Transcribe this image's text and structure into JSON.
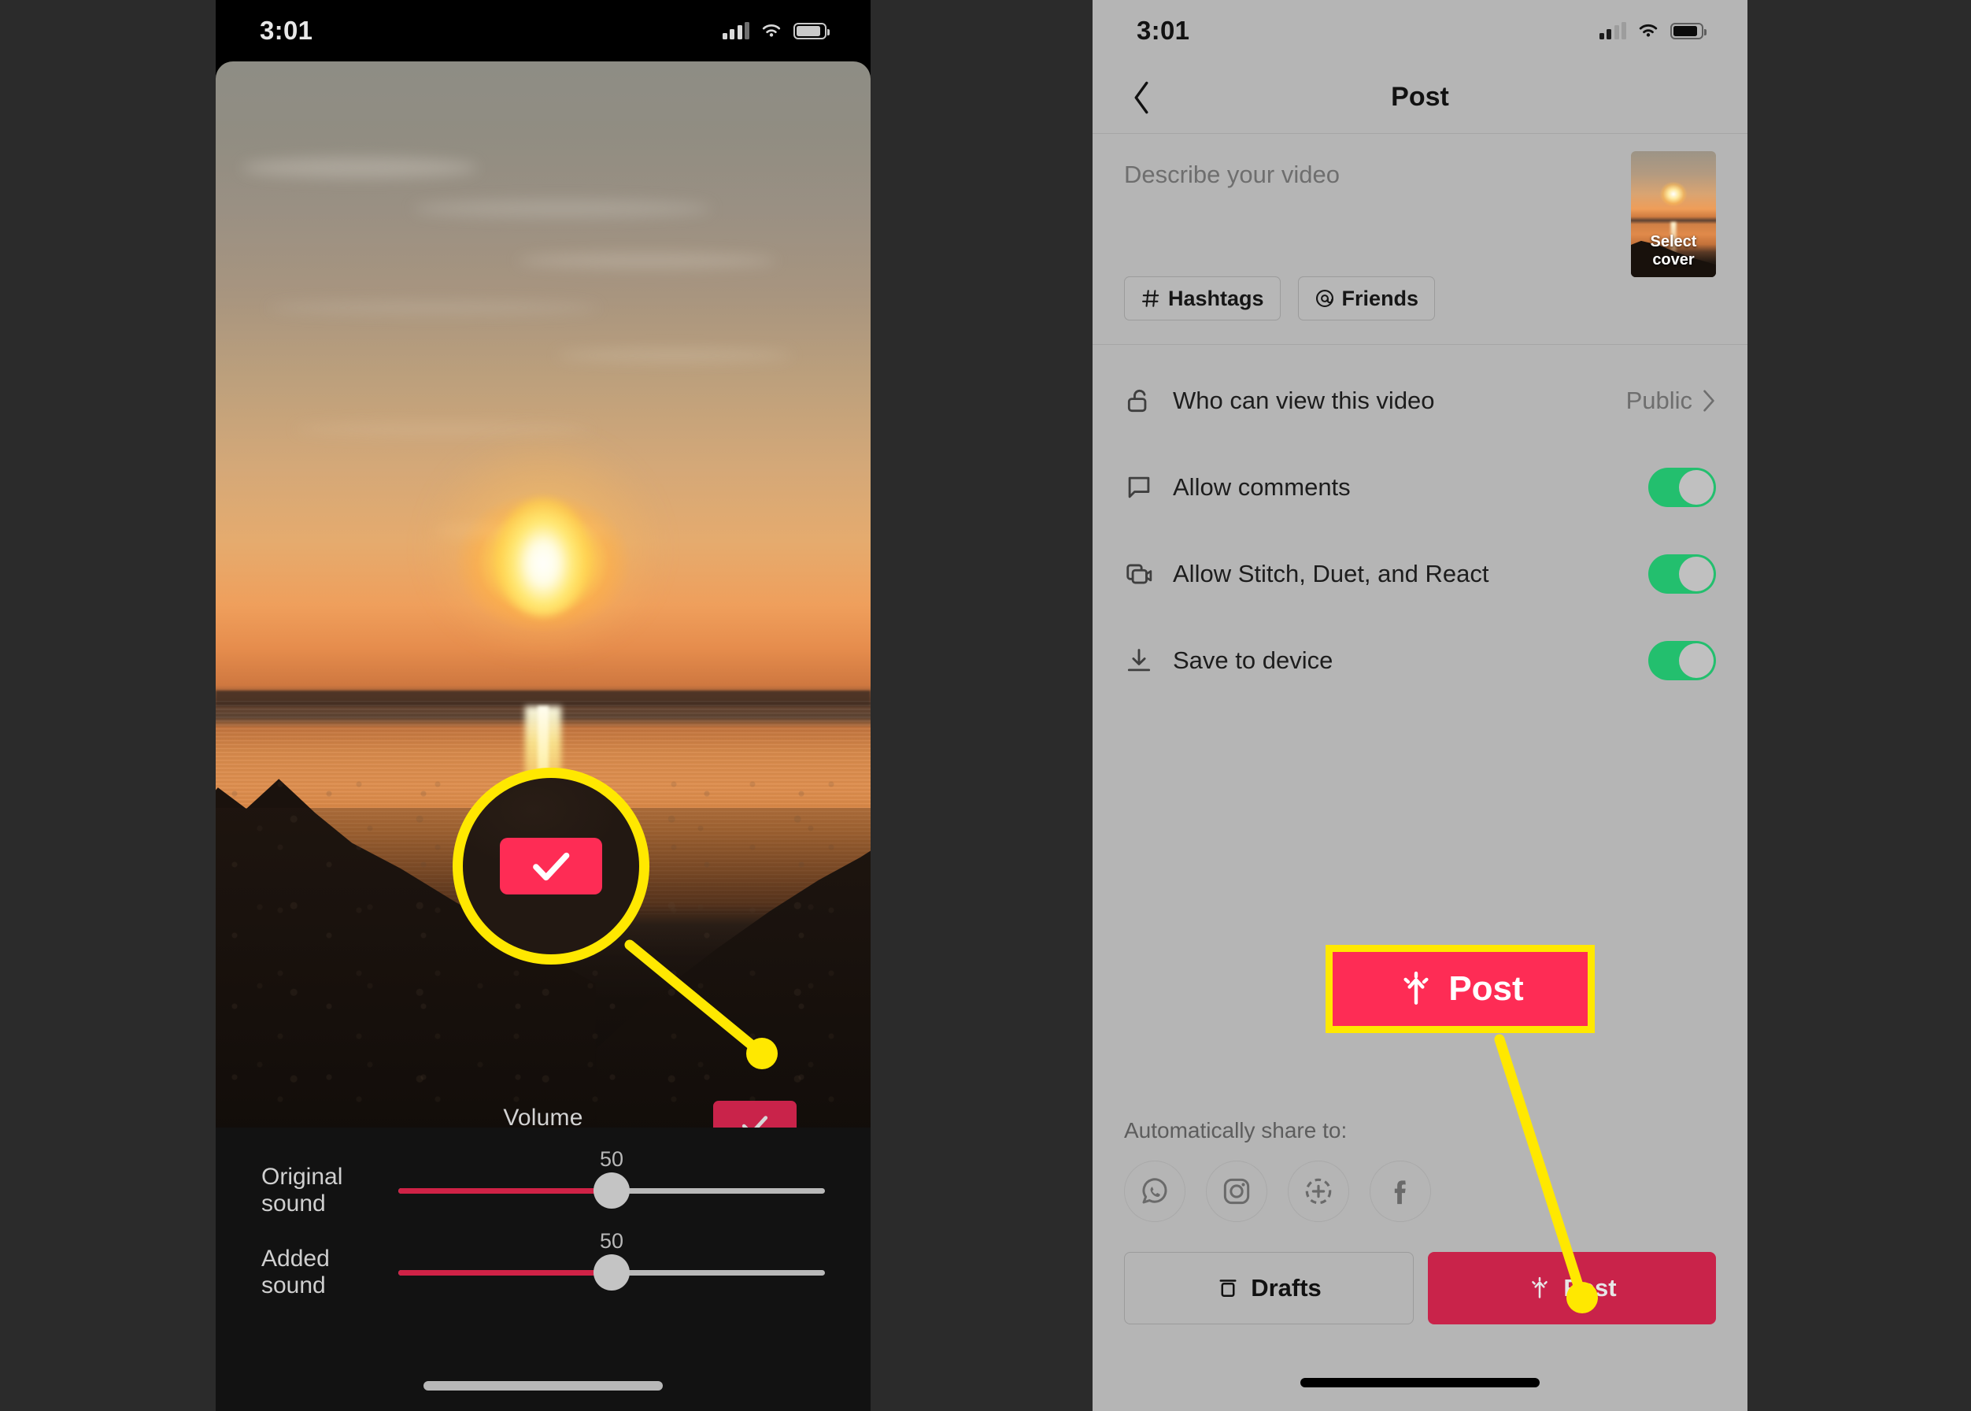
{
  "background_color": "#2b2b2b",
  "accent": {
    "tiktok_pink": "#fe2c55",
    "btn_red": "#c9234a",
    "toggle_green": "#23bf6e",
    "callout_yellow": "#ffe800"
  },
  "phone_left": {
    "status_bar": {
      "time": "3:01",
      "signal_icon": "signal-bars-icon",
      "wifi_icon": "wifi-icon",
      "battery_icon": "battery-icon"
    },
    "video": {
      "alt": "sunset over sea with rocky shore"
    },
    "volume_label": "Volume",
    "confirm_button": {
      "icon": "check-icon"
    },
    "sliders": [
      {
        "label": "Original sound",
        "value": "50",
        "percent": 50
      },
      {
        "label": "Added sound",
        "value": "50",
        "percent": 50
      }
    ],
    "home_indicator": "home-indicator"
  },
  "phone_right": {
    "status_bar": {
      "time": "3:01",
      "signal_icon": "signal-bars-icon",
      "wifi_icon": "wifi-icon",
      "battery_icon": "battery-icon"
    },
    "nav": {
      "back_icon": "chevron-left-icon",
      "title": "Post"
    },
    "describe": {
      "placeholder": "Describe your video",
      "chips": [
        {
          "icon": "hashtag-icon",
          "label": "Hashtags"
        },
        {
          "icon": "at-mention-icon",
          "label": "Friends"
        }
      ],
      "cover": {
        "label": "Select cover"
      }
    },
    "settings": [
      {
        "icon": "unlock-icon",
        "label": "Who can view this video",
        "value": "Public",
        "control": "chevron",
        "chevron_icon": "chevron-right-icon"
      },
      {
        "icon": "comment-icon",
        "label": "Allow comments",
        "control": "toggle",
        "on": true
      },
      {
        "icon": "stitch-icon",
        "label": "Allow Stitch, Duet, and React",
        "control": "toggle",
        "on": true
      },
      {
        "icon": "download-icon",
        "label": "Save to device",
        "control": "toggle",
        "on": true
      }
    ],
    "share": {
      "label": "Automatically share to:",
      "icons": [
        {
          "name": "whatsapp-icon"
        },
        {
          "name": "instagram-icon"
        },
        {
          "name": "instagram-stories-icon"
        },
        {
          "name": "facebook-icon"
        }
      ]
    },
    "bottom_buttons": {
      "drafts": {
        "icon": "drafts-icon",
        "label": "Drafts"
      },
      "post": {
        "icon": "post-upload-icon",
        "label": "Post"
      }
    },
    "home_indicator": "home-indicator"
  },
  "annotations": {
    "magnifier": {
      "target": "confirm-check-button",
      "icon": "check-icon"
    },
    "callout_post": {
      "icon": "post-upload-icon",
      "label": "Post"
    }
  }
}
